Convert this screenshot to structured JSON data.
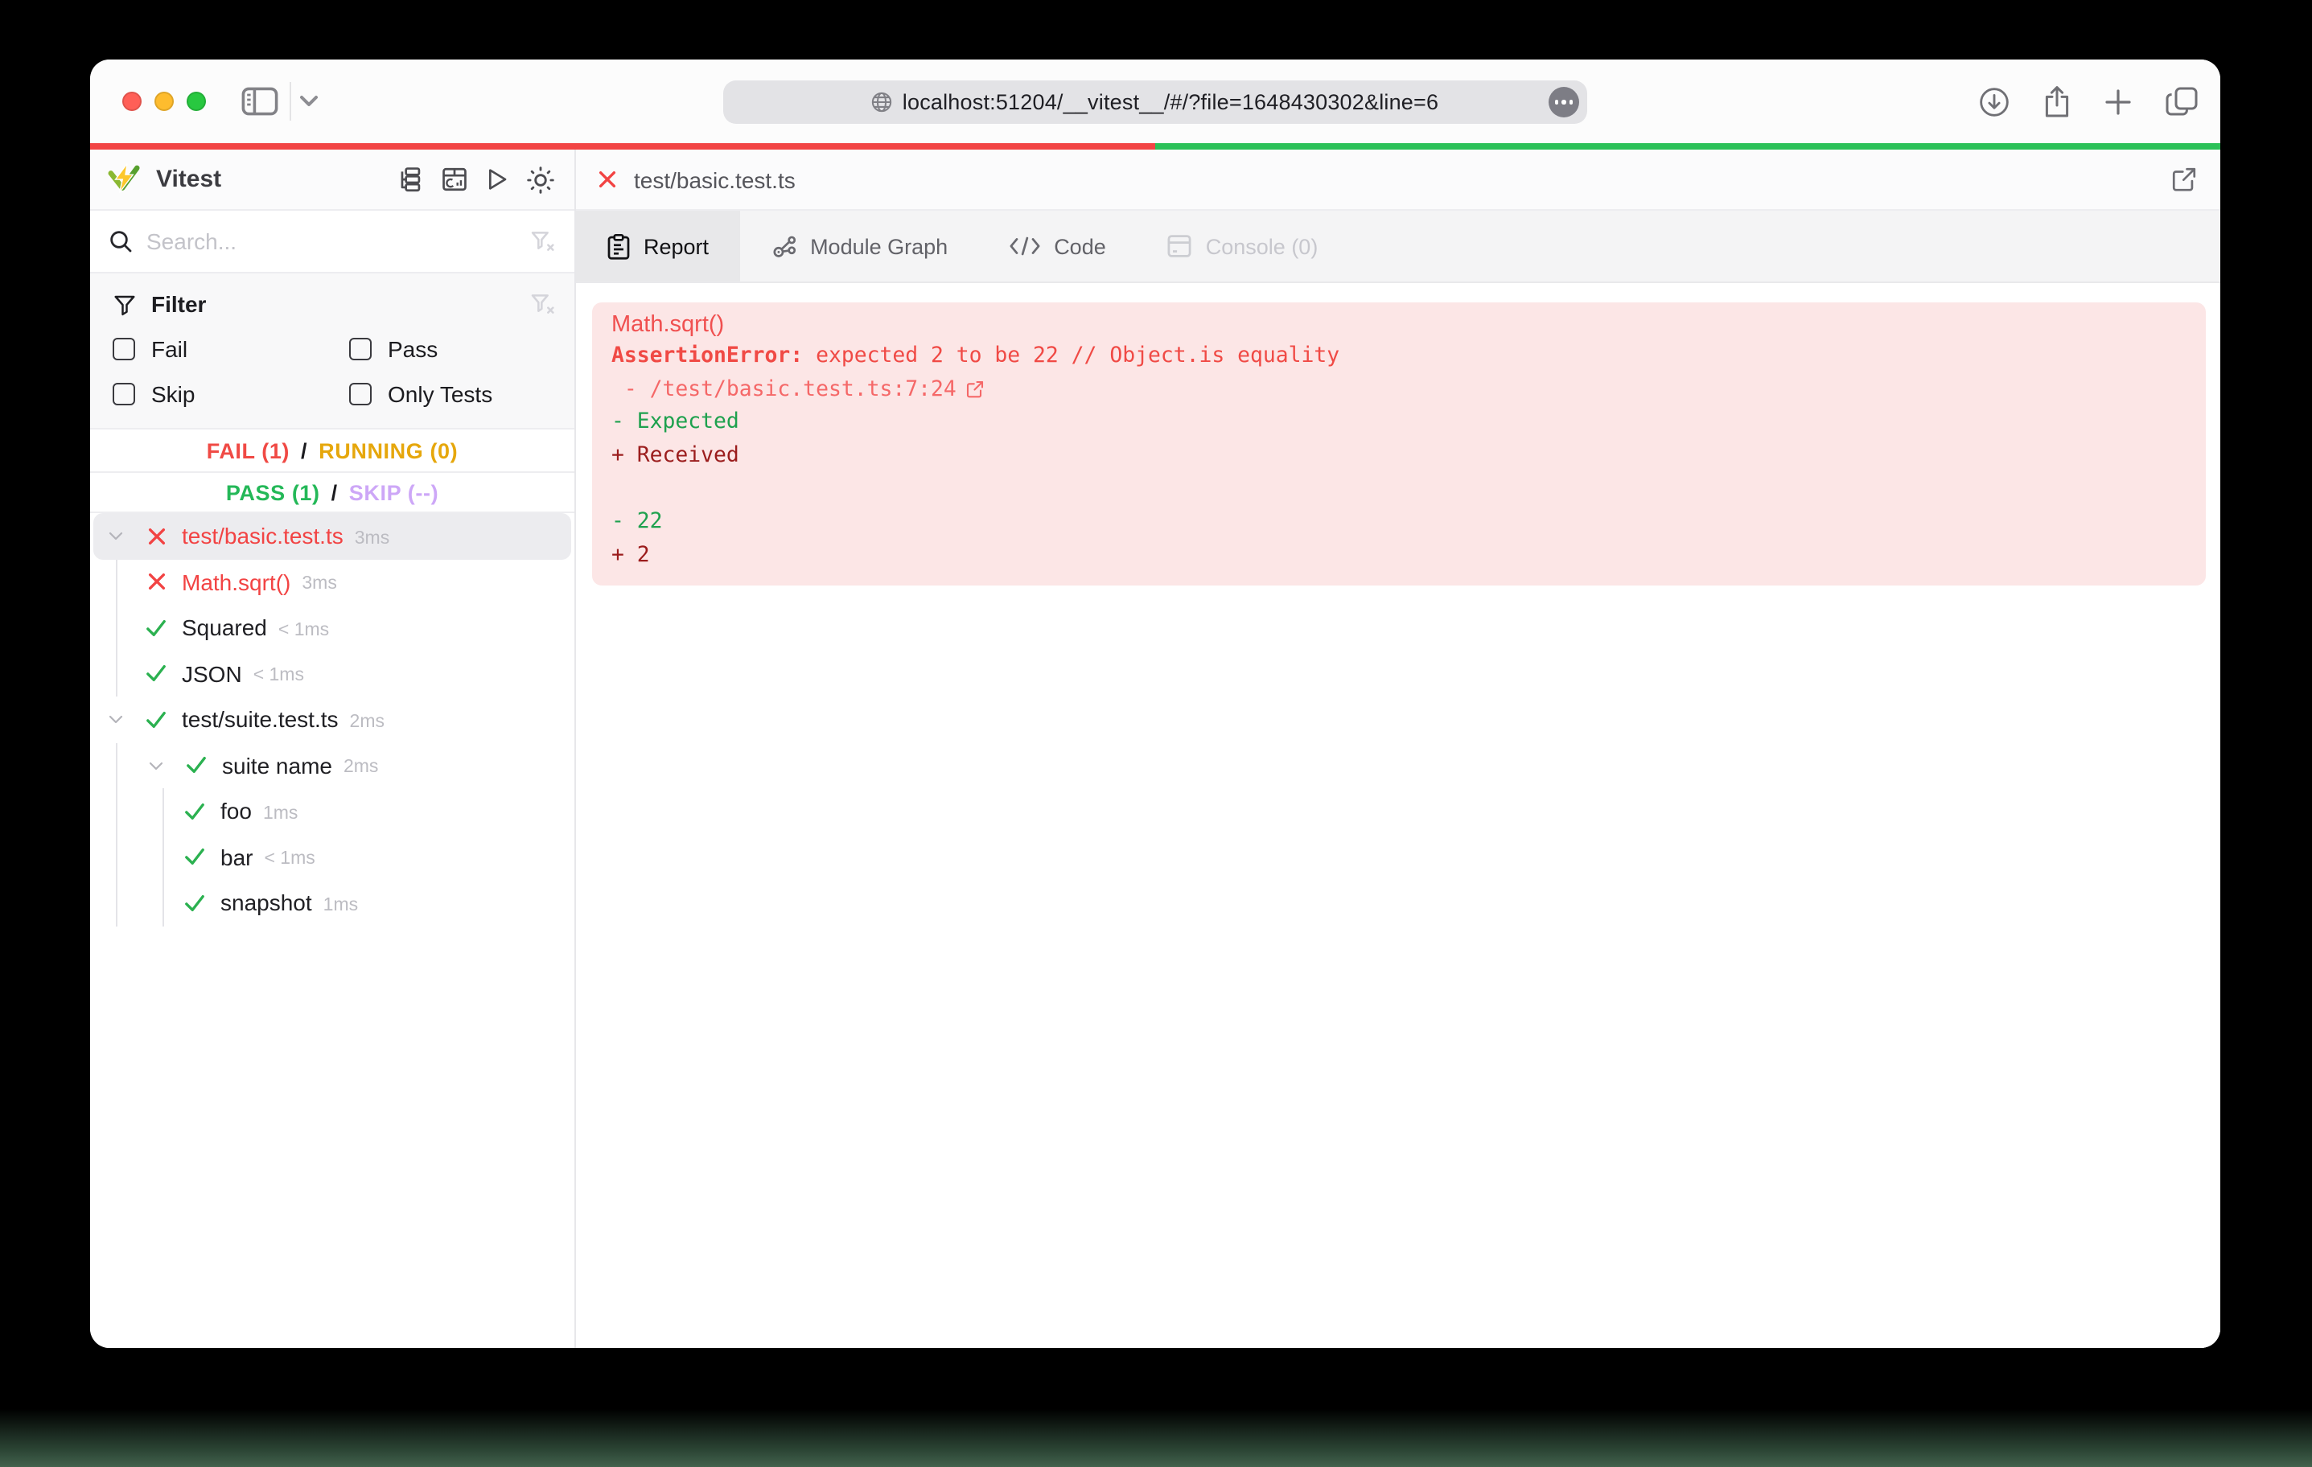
{
  "browser": {
    "url": "localhost:51204/__vitest__/#/?file=1648430302&line=6"
  },
  "progress": {
    "fail_color": "#f24444",
    "pass_color": "#2bc158",
    "fail_fraction": 0.5
  },
  "sidebar": {
    "title": "Vitest",
    "search_placeholder": "Search...",
    "filter": {
      "title": "Filter",
      "options": [
        {
          "label": "Fail"
        },
        {
          "label": "Pass"
        },
        {
          "label": "Skip"
        },
        {
          "label": "Only Tests"
        }
      ]
    },
    "summary": {
      "line1": [
        {
          "text": "FAIL (1)",
          "color": "#f04a45"
        },
        {
          "text": "/",
          "color": "#1b1b1f"
        },
        {
          "text": "RUNNING (0)",
          "color": "#e6a70c"
        }
      ],
      "line2": [
        {
          "text": "PASS (1)",
          "color": "#24b858"
        },
        {
          "text": "/",
          "color": "#1b1b1f"
        },
        {
          "text": "SKIP (--)",
          "color": "#cda7f7"
        }
      ]
    },
    "tree": [
      {
        "label": "test/basic.test.ts",
        "duration": "3ms",
        "status": "fail",
        "level": 0,
        "chevron": true,
        "selected": true
      },
      {
        "label": "Math.sqrt()",
        "duration": "3ms",
        "status": "fail",
        "level": 1,
        "chevron": false,
        "selected": false
      },
      {
        "label": "Squared",
        "duration": "< 1ms",
        "status": "pass",
        "level": 1,
        "chevron": false,
        "selected": false
      },
      {
        "label": "JSON",
        "duration": "< 1ms",
        "status": "pass",
        "level": 1,
        "chevron": false,
        "selected": false
      },
      {
        "label": "test/suite.test.ts",
        "duration": "2ms",
        "status": "pass",
        "level": 0,
        "chevron": true,
        "selected": false
      },
      {
        "label": "suite name",
        "duration": "2ms",
        "status": "pass",
        "level": 1,
        "chevron": true,
        "selected": false
      },
      {
        "label": "foo",
        "duration": "1ms",
        "status": "pass",
        "level": 2,
        "chevron": false,
        "selected": false
      },
      {
        "label": "bar",
        "duration": "< 1ms",
        "status": "pass",
        "level": 2,
        "chevron": false,
        "selected": false
      },
      {
        "label": "snapshot",
        "duration": "1ms",
        "status": "pass",
        "level": 2,
        "chevron": false,
        "selected": false
      }
    ]
  },
  "main": {
    "file_tab": {
      "label": "test/basic.test.ts"
    },
    "tabs": [
      {
        "label": "Report",
        "icon": "report",
        "state": "active"
      },
      {
        "label": "Module Graph",
        "icon": "graph",
        "state": "normal"
      },
      {
        "label": "Code",
        "icon": "code",
        "state": "normal"
      },
      {
        "label": "Console (0)",
        "icon": "console",
        "state": "disabled"
      }
    ],
    "error_panel": {
      "bg": "#fce6e6",
      "lines": [
        {
          "kind": "title",
          "text": "Math.sqrt()",
          "color": "#f05050"
        },
        {
          "kind": "error",
          "bold": "AssertionError: ",
          "text": "expected 2 to be 22 // Object.is equality",
          "color": "#f04a45"
        },
        {
          "kind": "stack",
          "text": " - /test/basic.test.ts:7:24",
          "icon": "external-link-icon",
          "color": "#f56868"
        },
        {
          "kind": "expected",
          "text": "- Expected",
          "color": "#1ea14e"
        },
        {
          "kind": "received",
          "text": "+ Received",
          "color": "#9b1d1d"
        },
        {
          "kind": "blank",
          "text": "",
          "color": "#9b1d1d"
        },
        {
          "kind": "expected",
          "text": "- 22",
          "color": "#1ea14e"
        },
        {
          "kind": "received",
          "text": "+ 2",
          "color": "#9b1d1d"
        }
      ]
    }
  }
}
